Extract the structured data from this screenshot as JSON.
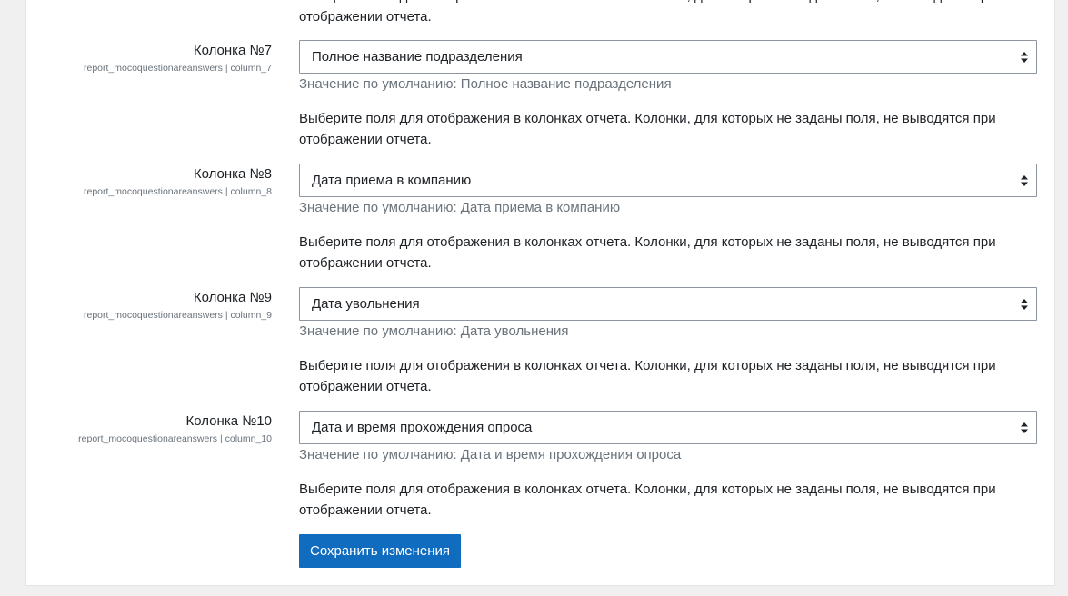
{
  "top_text": "Выберите поля для отображения в колонках отчета. Колонки, для которых не заданы поля, не выводятся при отображении отчета.",
  "settings": [
    {
      "label": "Колонка №7",
      "key": "report_mocoquestionareanswers | column_7",
      "value": "Полное название подразделения",
      "default": "Значение по умолчанию: Полное название подразделения",
      "description": "Выберите поля для отображения в колонках отчета. Колонки, для которых не заданы поля, не выводятся при отображении отчета."
    },
    {
      "label": "Колонка №8",
      "key": "report_mocoquestionareanswers | column_8",
      "value": "Дата приема в компанию",
      "default": "Значение по умолчанию: Дата приема в компанию",
      "description": "Выберите поля для отображения в колонках отчета. Колонки, для которых не заданы поля, не выводятся при отображении отчета."
    },
    {
      "label": "Колонка №9",
      "key": "report_mocoquestionareanswers | column_9",
      "value": "Дата увольнения",
      "default": "Значение по умолчанию: Дата увольнения",
      "description": "Выберите поля для отображения в колонках отчета. Колонки, для которых не заданы поля, не выводятся при отображении отчета."
    },
    {
      "label": "Колонка №10",
      "key": "report_mocoquestionareanswers | column_10",
      "value": "Дата и время прохождения опроса",
      "default": "Значение по умолчанию: Дата и время прохождения опроса",
      "description": "Выберите поля для отображения в колонках отчета. Колонки, для которых не заданы поля, не выводятся при отображении отчета."
    }
  ],
  "save_label": "Сохранить изменения",
  "colors": {
    "primary": "#0f6cbf",
    "muted_text": "#6a737b",
    "border": "#8f959e"
  }
}
